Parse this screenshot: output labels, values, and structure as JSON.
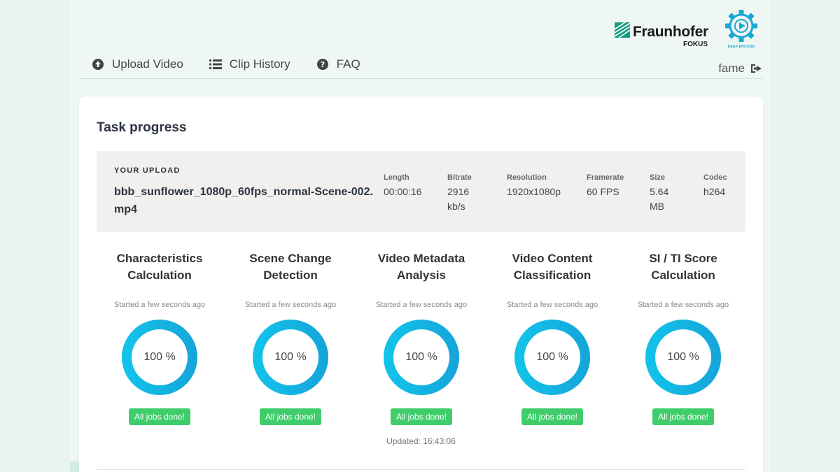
{
  "logos": {
    "fraunhofer_name": "Fraunhofer",
    "fraunhofer_sub": "FOKUS",
    "deep_encode_label": "DEEP ENCODE",
    "accent_color": "#1aa7d6",
    "fraunhofer_color": "#179c7d"
  },
  "nav": {
    "items": [
      {
        "label": "Upload Video",
        "icon": "upload-icon"
      },
      {
        "label": "Clip History",
        "icon": "list-icon"
      },
      {
        "label": "FAQ",
        "icon": "question-icon"
      }
    ]
  },
  "user": {
    "name": "fame",
    "logout_icon": "logout-icon"
  },
  "card": {
    "title": "Task progress",
    "upload": {
      "label": "YOUR UPLOAD",
      "filename": "bbb_sunflower_1080p_60fps_normal-Scene-002.mp4",
      "meta": [
        {
          "label": "Length",
          "value": "00:00:16"
        },
        {
          "label": "Bitrate",
          "value": "2916 kb/s"
        },
        {
          "label": "Resolution",
          "value": "1920x1080p"
        },
        {
          "label": "Framerate",
          "value": "60 FPS"
        },
        {
          "label": "Size",
          "value": "5.64 MB"
        },
        {
          "label": "Codec",
          "value": "h264"
        }
      ]
    },
    "tasks": [
      {
        "title": "Characteristics Calculation",
        "started": "Started a few seconds ago",
        "progress": 100,
        "progress_text": "100 %",
        "status": "All jobs done!"
      },
      {
        "title": "Scene Change Detection",
        "started": "Started a few seconds ago",
        "progress": 100,
        "progress_text": "100 %",
        "status": "All jobs done!"
      },
      {
        "title": "Video Metadata Analysis",
        "started": "Started a few seconds ago",
        "progress": 100,
        "progress_text": "100 %",
        "status": "All jobs done!"
      },
      {
        "title": "Video Content Classification",
        "started": "Started a few seconds ago",
        "progress": 100,
        "progress_text": "100 %",
        "status": "All jobs done!"
      },
      {
        "title": "SI / TI Score Calculation",
        "started": "Started a few seconds ago",
        "progress": 100,
        "progress_text": "100 %",
        "status": "All jobs done!"
      }
    ],
    "updated": "Updated: 16:43:06",
    "colors": {
      "ring": "#12c2e9",
      "ring_dark": "#14a6db",
      "badge": "#3fcd6c"
    }
  }
}
